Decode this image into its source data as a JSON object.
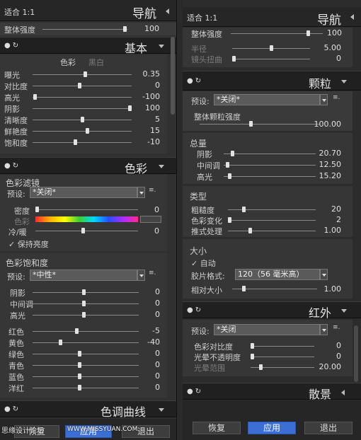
{
  "left": {
    "nav": {
      "fit": "适合  1:1",
      "title": "导航"
    },
    "overall": {
      "label": "整体强度",
      "value": "100"
    },
    "basic": {
      "title": "基本",
      "tabs": [
        "色彩",
        "黑白"
      ],
      "sliders": [
        {
          "label": "曝光",
          "value": "0.35"
        },
        {
          "label": "对比度",
          "value": "0"
        },
        {
          "label": "高光",
          "value": "-100"
        },
        {
          "label": "阴影",
          "value": "100"
        },
        {
          "label": "清晰度",
          "value": "5"
        },
        {
          "label": "鲜艳度",
          "value": "15"
        },
        {
          "label": "饱和度",
          "value": "-10"
        }
      ]
    },
    "color": {
      "title": "色彩",
      "filter": {
        "title": "色彩滤镜",
        "preset_label": "预设:",
        "preset_value": "*关闭*",
        "density_label": "密度",
        "density_value": "0",
        "color_label": "色彩",
        "tone_label": "冷/暖",
        "tone_value": "0",
        "keep_label": "保持亮度"
      },
      "saturation": {
        "title": "色彩饱和度",
        "preset_label": "预设:",
        "preset_value": "*中性*",
        "tones": [
          {
            "label": "阴影",
            "value": "0"
          },
          {
            "label": "中间调",
            "value": "0"
          },
          {
            "label": "高光",
            "value": "0"
          }
        ],
        "channels": [
          {
            "label": "红色",
            "value": "-5"
          },
          {
            "label": "黄色",
            "value": "-40"
          },
          {
            "label": "绿色",
            "value": "0"
          },
          {
            "label": "青色",
            "value": "0"
          },
          {
            "label": "蓝色",
            "value": "0"
          },
          {
            "label": "洋红",
            "value": "0"
          }
        ]
      }
    },
    "curves": {
      "title": "色调曲线"
    },
    "buttons": {
      "reset": "恢复",
      "apply": "应用",
      "exit": "退出"
    },
    "watermark": "思缘设计论坛",
    "watermark_url": "WWW.MISSYUAN.COM"
  },
  "right": {
    "nav": {
      "fit": "适合  1:1",
      "title": "导航"
    },
    "overall": {
      "label": "整体强度",
      "value": "100"
    },
    "vignette": [
      {
        "label": "半径",
        "value": "5.00"
      },
      {
        "label": "镜头扭曲",
        "value": "0"
      }
    ],
    "grain": {
      "title": "颗粒",
      "preset_label": "预设:",
      "preset_value": "*关闭*",
      "overall_label": "整体颗粒强度",
      "overall_value": "100.00",
      "amount_title": "总量",
      "amounts": [
        {
          "label": "阴影",
          "value": "20.70"
        },
        {
          "label": "中间调",
          "value": "12.50"
        },
        {
          "label": "高光",
          "value": "15.20"
        }
      ],
      "type_title": "类型",
      "types": [
        {
          "label": "粗糙度",
          "value": "20"
        },
        {
          "label": "色彩变化",
          "value": "2"
        },
        {
          "label": "推式处理",
          "value": "1.00"
        }
      ],
      "size_title": "大小",
      "auto_label": "自动",
      "film_label": "胶片格式:",
      "film_value": "120（56 毫米高）",
      "rel_label": "相对大小",
      "rel_value": "1.00"
    },
    "ir": {
      "title": "红外",
      "preset_label": "预设:",
      "preset_value": "*关闭",
      "sliders": [
        {
          "label": "色彩对比度",
          "value": "0"
        },
        {
          "label": "光晕不透明度",
          "value": "0"
        },
        {
          "label": "光晕范围",
          "value": "20.00"
        }
      ]
    },
    "scatter": {
      "title": "散景"
    },
    "buttons": {
      "reset": "恢复",
      "apply": "应用",
      "exit": "退出"
    }
  }
}
